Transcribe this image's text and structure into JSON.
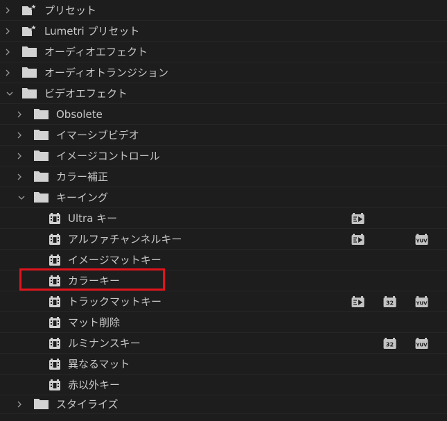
{
  "tree": {
    "presets": {
      "label": "プリセット"
    },
    "lumetri_presets": {
      "label": "Lumetri プリセット"
    },
    "audio_effects": {
      "label": "オーディオエフェクト"
    },
    "audio_transitions": {
      "label": "オーディオトランジション"
    },
    "video_effects": {
      "label": "ビデオエフェクト",
      "children": {
        "obsolete": {
          "label": "Obsolete"
        },
        "immersive_video": {
          "label": "イマーシブビデオ"
        },
        "image_control": {
          "label": "イメージコントロール"
        },
        "color_correction": {
          "label": "カラー補正"
        },
        "keying": {
          "label": "キーイング",
          "items": [
            {
              "label": "Ultra キー"
            },
            {
              "label": "アルファチャンネルキー"
            },
            {
              "label": "イメージマットキー"
            },
            {
              "label": "カラーキー"
            },
            {
              "label": "トラックマットキー"
            },
            {
              "label": "マット削除"
            },
            {
              "label": "ルミナンスキー"
            },
            {
              "label": "異なるマット"
            },
            {
              "label": "赤以外キー"
            }
          ]
        },
        "stylize": {
          "label": "スタイライズ"
        }
      }
    }
  },
  "badges": {
    "b32": "32",
    "yuv": "YUV"
  },
  "colors": {
    "background": "#1d1d1d",
    "text": "#c8c8c8",
    "icon": "#d2d2d2",
    "highlight": "#e0141c"
  }
}
